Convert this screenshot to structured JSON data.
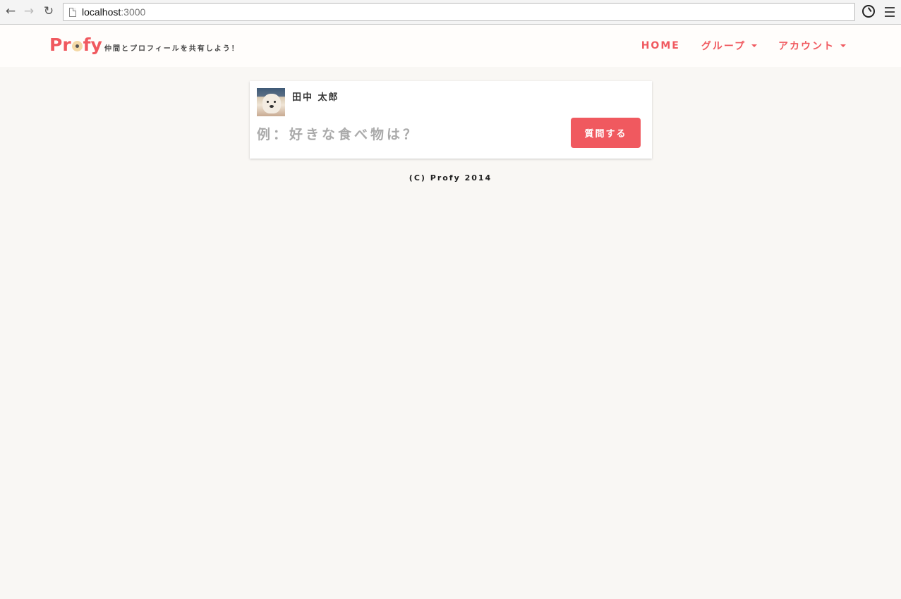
{
  "browser": {
    "back_icon": "←",
    "forward_icon": "→",
    "reload_icon": "↻",
    "url_host": "localhost",
    "url_port": ":3000"
  },
  "header": {
    "logo_parts": {
      "p": "Pr",
      "rest": "fy"
    },
    "tagline": "仲間とプロフィールを共有しよう！",
    "nav": {
      "home": "HOME",
      "group": "グループ",
      "account": "アカウント"
    }
  },
  "question_card": {
    "user_name": "田中 太郎",
    "input_placeholder": "例：好きな食べ物は？",
    "input_value": "",
    "ask_button": "質問する"
  },
  "footer": {
    "copyright": "(C) Profy 2014"
  },
  "colors": {
    "accent": "#f0595f",
    "background": "#f9f7f4"
  }
}
